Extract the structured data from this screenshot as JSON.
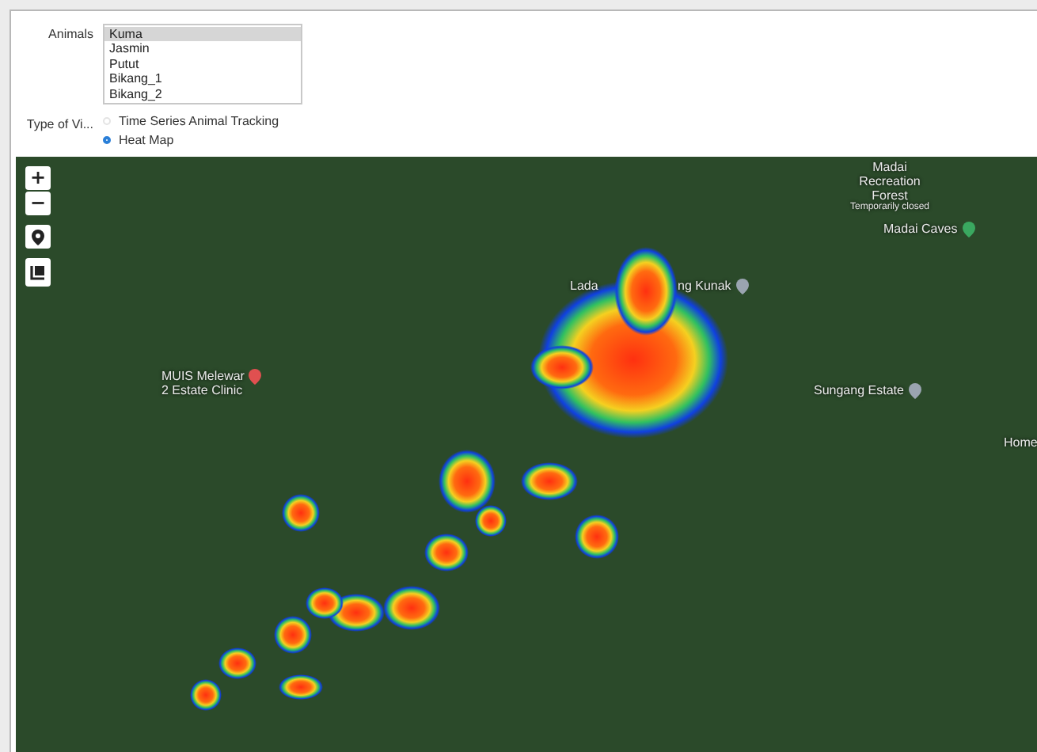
{
  "animals": {
    "label": "Animals",
    "items": [
      {
        "label": "Kuma",
        "selected": true
      },
      {
        "label": "Jasmin",
        "selected": false
      },
      {
        "label": "Putut",
        "selected": false
      },
      {
        "label": "Bikang_1",
        "selected": false
      },
      {
        "label": "Bikang_2",
        "selected": false
      }
    ]
  },
  "view_type": {
    "label": "Type of Vi...",
    "options": [
      {
        "label": "Time Series Animal Tracking",
        "selected": false
      },
      {
        "label": "Heat Map",
        "selected": true
      }
    ]
  },
  "map": {
    "controls": [
      {
        "kind": "zoom_in",
        "label": "+"
      },
      {
        "kind": "zoom_out",
        "label": "−"
      },
      {
        "kind": "pin"
      },
      {
        "kind": "layers"
      }
    ],
    "places": [
      {
        "kind": "park",
        "lines": [
          "Madai",
          "Recreation",
          "Forest"
        ],
        "note": "Temporarily closed"
      },
      {
        "kind": "park",
        "lines": [
          "Madai Caves"
        ]
      },
      {
        "kind": "none",
        "lines": [
          "Lada"
        ]
      },
      {
        "kind": "place",
        "lines": [
          "ng Kunak"
        ]
      },
      {
        "kind": "clinic",
        "lines": [
          "MUIS Melewar",
          "2 Estate Clinic"
        ]
      },
      {
        "kind": "place",
        "lines": [
          "Sungang Estate"
        ]
      },
      {
        "kind": "none",
        "lines": [
          "Home"
        ]
      }
    ]
  }
}
